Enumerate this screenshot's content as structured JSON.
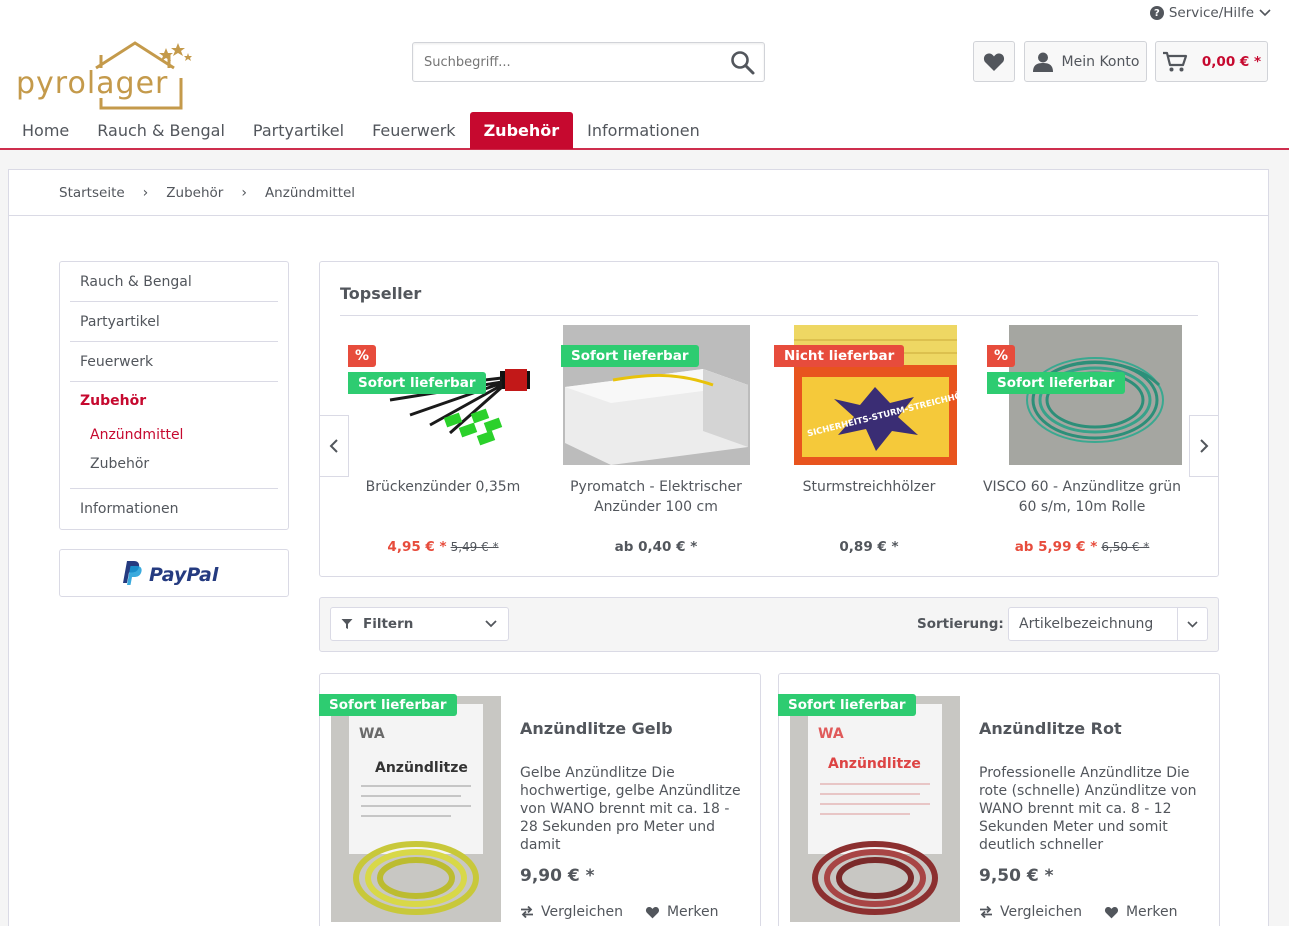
{
  "header": {
    "service_label": "Service/Hilfe",
    "logo_text": "pyrolager",
    "search_placeholder": "Suchbegriff...",
    "account_label": "Mein Konto",
    "cart_total": "0,00 € *"
  },
  "nav": {
    "items": [
      "Home",
      "Rauch & Bengal",
      "Partyartikel",
      "Feuerwerk",
      "Zubehör",
      "Informationen"
    ],
    "active": "Zubehör"
  },
  "breadcrumb": [
    "Startseite",
    "Zubehör",
    "Anzündmittel"
  ],
  "sidebar": {
    "items": [
      "Rauch & Bengal",
      "Partyartikel",
      "Feuerwerk",
      "Zubehör",
      "Informationen"
    ],
    "subitems": [
      "Anzündmittel",
      "Zubehör"
    ],
    "active_item": "Zubehör",
    "active_subitem": "Anzündmittel",
    "paypal_label": "PayPal"
  },
  "topseller": {
    "title": "Topseller",
    "items": [
      {
        "name": "Brückenzünder 0,35m",
        "price": "4,95 € *",
        "old_price": "5,49 € *",
        "badge": "Sofort lieferbar",
        "discount": "%"
      },
      {
        "name": "Pyromatch - Elektrischer Anzünder 100 cm",
        "price": "ab 0,40 € *",
        "old_price": "",
        "badge": "Sofort lieferbar",
        "discount": ""
      },
      {
        "name": "Sturmstreichhölzer",
        "price": "0,89 € *",
        "old_price": "",
        "badge": "Nicht lieferbar",
        "discount": ""
      },
      {
        "name": "VISCO 60 - Anzündlitze grün 60 s/m, 10m Rolle",
        "price": "ab 5,99 € *",
        "old_price": "6,50 € *",
        "badge": "Sofort lieferbar",
        "discount": "%"
      }
    ],
    "image_texts": {
      "matches": "SICHERHEITS-STURM-STREICHHÖLZER"
    }
  },
  "filter": {
    "filter_label": "Filtern",
    "sort_label": "Sortierung:",
    "sort_value": "Artikelbezeichnung"
  },
  "products": [
    {
      "title": "Anzündlitze Gelb",
      "desc": "Gelbe Anzündlitze Die hochwertige, gelbe Anzündlitze von WANO brennt mit ca. 18 - 28 Sekunden pro Meter und damit",
      "price": "9,90 € *",
      "badge": "Sofort lieferbar",
      "compare": "Vergleichen",
      "remember": "Merken",
      "pack_label": "Anzündlitze",
      "pack_brand": "WA"
    },
    {
      "title": "Anzündlitze Rot",
      "desc": "Professionelle Anzündlitze Die rote (schnelle) Anzündlitze von WANO brennt mit ca. 8 - 12 Sekunden Meter und somit deutlich schneller",
      "price": "9,50 € *",
      "badge": "Sofort lieferbar",
      "compare": "Vergleichen",
      "remember": "Merken",
      "pack_label": "Anzündlitze",
      "pack_brand": "WA"
    }
  ],
  "colors": {
    "brand": "#c6092f",
    "green_badge": "#2ecc71",
    "red_badge": "#e74c3c",
    "logo_gold": "#c49a4b"
  }
}
